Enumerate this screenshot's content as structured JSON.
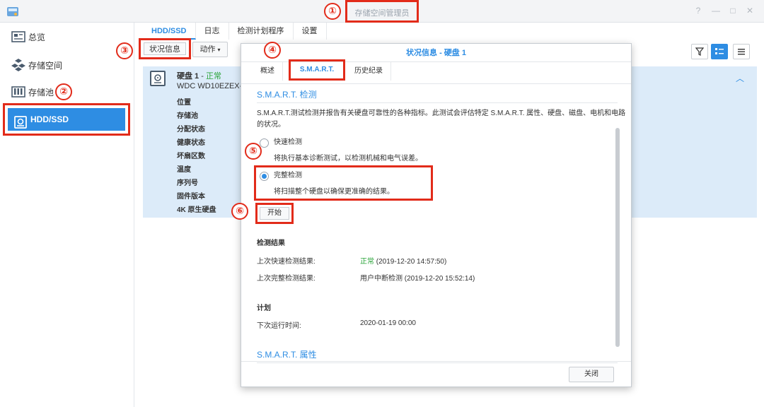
{
  "window": {
    "title": "存储空间管理员",
    "controls": {
      "help": "?",
      "minimize": "—",
      "maximize": "□",
      "close": "✕"
    }
  },
  "sidebar": {
    "items": [
      {
        "label": "总览",
        "icon": "overview-icon"
      },
      {
        "label": "存储空间",
        "icon": "volume-icon"
      },
      {
        "label": "存储池",
        "icon": "storage-pool-icon"
      },
      {
        "label": "HDD/SSD",
        "icon": "disk-icon",
        "selected": true
      }
    ]
  },
  "tabs": [
    {
      "label": "HDD/SSD",
      "active": true
    },
    {
      "label": "日志"
    },
    {
      "label": "检测计划程序"
    },
    {
      "label": "设置"
    }
  ],
  "toolbar": {
    "status_info": "状况信息",
    "action": "动作",
    "filter_icon": "filter-icon",
    "view_list_icon": "list-view-icon",
    "view_detail_icon": "detail-view-icon"
  },
  "disk": {
    "name": "硬盘 1",
    "separator": " - ",
    "status": "正常",
    "model": "WDC WD10EZEX-0",
    "labels": [
      "位置",
      "存储池",
      "分配状态",
      "健康状态",
      "坏扇区数",
      "温度",
      "序列号",
      "固件版本",
      "4K 原生硬盘"
    ]
  },
  "dialog": {
    "title": "状况信息 - 硬盘 1",
    "tabs": [
      "概述",
      "S.M.A.R.T.",
      "历史纪录"
    ],
    "active_tab": "S.M.A.R.T.",
    "smart_test": {
      "title": "S.M.A.R.T. 检测",
      "description_line1": "S.M.A.R.T.测试检测并报告有关硬盘可靠性的各种指标。此测试会评估特定 S.M.A.R.T. 属性、硬盘、磁盘、电机和电路",
      "description_line2": "的状况。",
      "quick_label": "快速检测",
      "quick_desc": "将执行基本诊断测试，以检测机械和电气误差。",
      "full_label": "完整检测",
      "full_desc": "将扫描整个硬盘以确保更准确的结果。",
      "selected": "full",
      "start_button": "开始"
    },
    "results": {
      "title": "检测结果",
      "last_quick_label": "上次快速检测结果:",
      "last_quick_status": "正常",
      "last_quick_time": "(2019-12-20 14:57:50)",
      "last_full_label": "上次完整检测结果:",
      "last_full_value": "用户中断检测 (2019-12-20 15:52:14)"
    },
    "schedule": {
      "title": "计划",
      "next_run_label": "下次运行时间:",
      "next_run_value": "2020-01-19 00:00"
    },
    "attributes_title": "S.M.A.R.T. 属性",
    "close_button": "关闭"
  },
  "annotations": [
    "①",
    "②",
    "③",
    "④",
    "⑤",
    "⑥"
  ],
  "colors": {
    "accent": "#2e8de3",
    "highlight_red": "#e22b1a",
    "ok_green": "#2aa43a",
    "panel_bg": "#dcebf9"
  }
}
